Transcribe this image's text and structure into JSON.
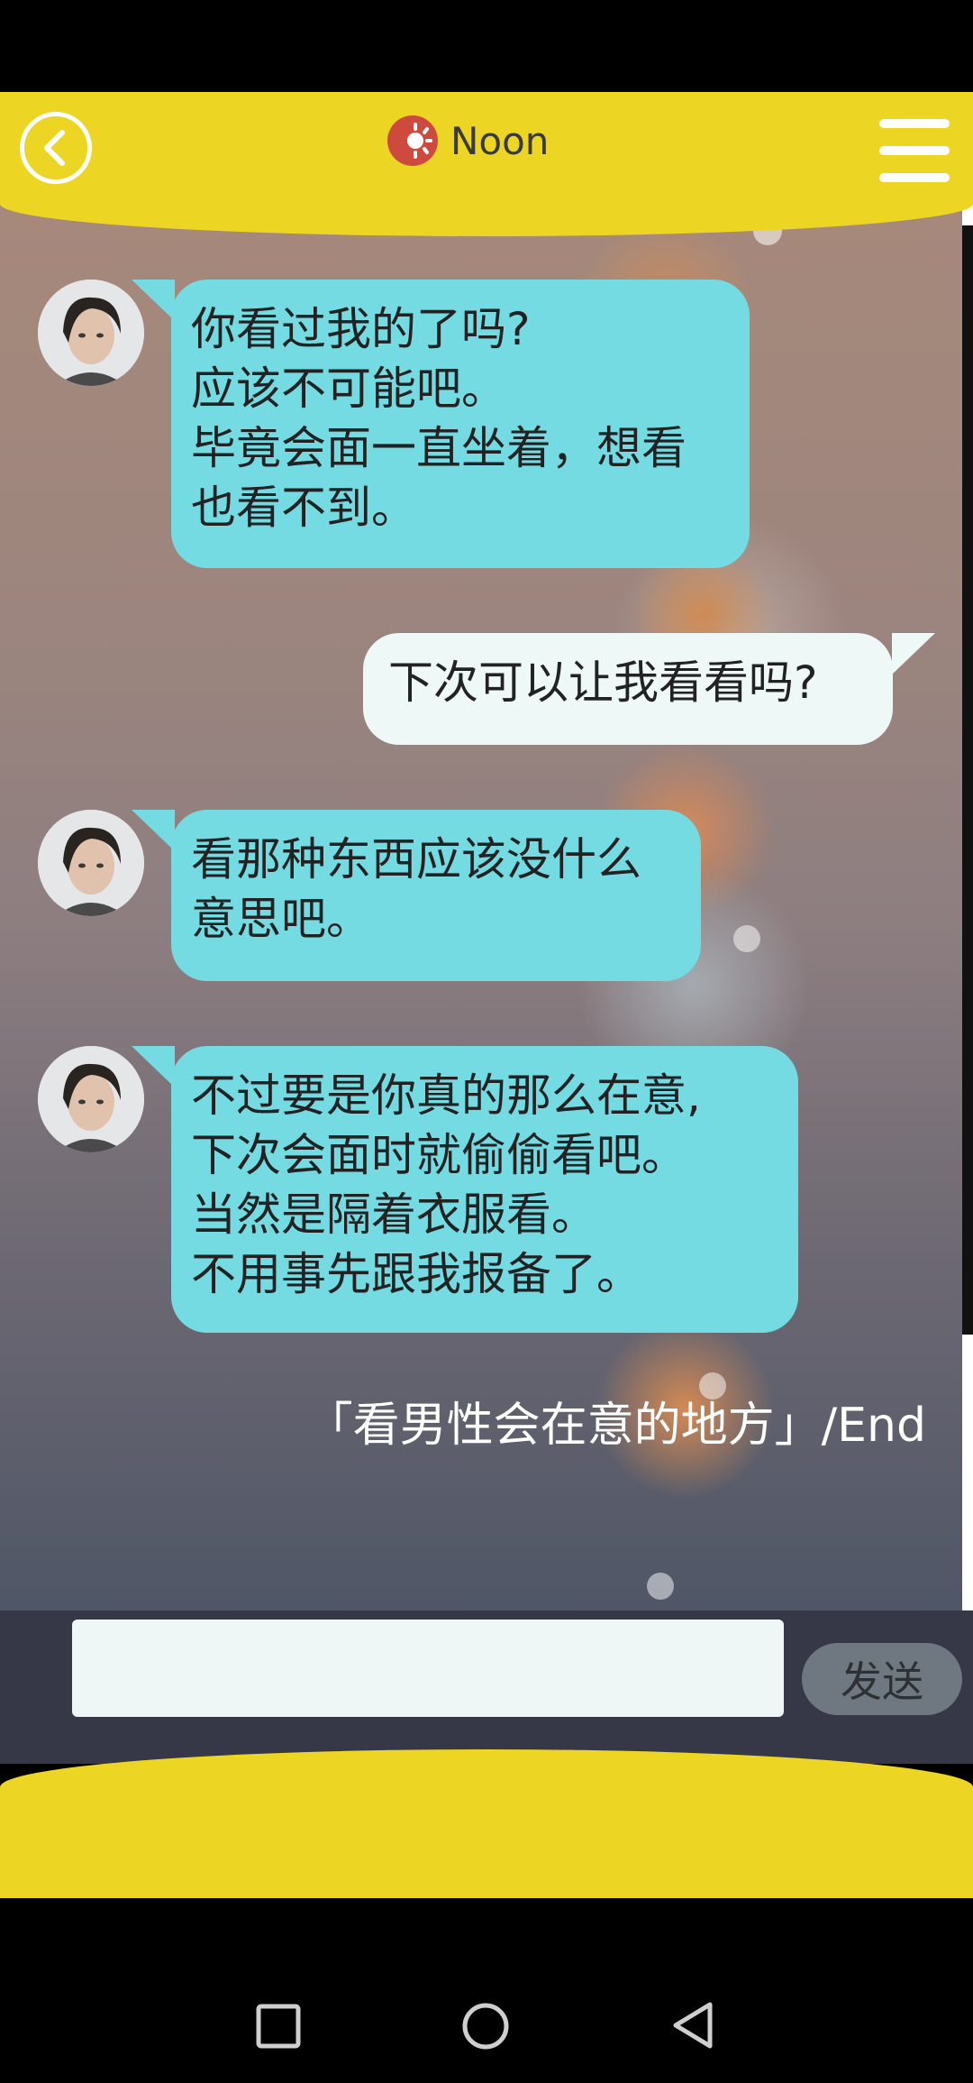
{
  "header": {
    "title": "Noon",
    "back_icon": "back-circle-icon",
    "menu_icon": "hamburger-menu-icon",
    "title_icon": "sun-icon",
    "accent_color": "#ecd523"
  },
  "messages": [
    {
      "sender": "character",
      "lines": [
        "你看过我的了吗?",
        "应该不可能吧。",
        "毕竟会面一直坐着，想看",
        "也看不到。"
      ]
    },
    {
      "sender": "user",
      "lines": [
        "下次可以让我看看吗?"
      ]
    },
    {
      "sender": "character",
      "lines": [
        "看那种东西应该没什么",
        "意思吧。"
      ]
    },
    {
      "sender": "character",
      "lines": [
        "不过要是你真的那么在意,",
        "下次会面时就偷偷看吧。",
        "当然是隔着衣服看。",
        "不用事先跟我报备了。"
      ]
    }
  ],
  "end_text": "「看男性会在意的地方」/End",
  "composer": {
    "input_value": "",
    "send_label": "发送"
  },
  "colors": {
    "character_bubble": "#74dbe2",
    "user_bubble": "#eef8f7",
    "composer_bg": "#363848"
  },
  "nav": {
    "recents_icon": "square-recents-icon",
    "home_icon": "circle-home-icon",
    "back_icon": "triangle-back-icon"
  }
}
